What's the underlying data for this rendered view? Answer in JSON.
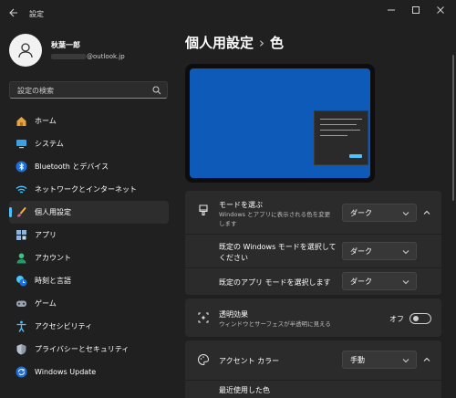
{
  "window": {
    "title": "設定",
    "back_icon": "arrow-left-icon",
    "controls": [
      "minimize-icon",
      "maximize-icon",
      "close-icon"
    ]
  },
  "profile": {
    "name": "秋葉一郎",
    "email_suffix": "@outlook.jp"
  },
  "search": {
    "placeholder": "設定の検索"
  },
  "sidebar": {
    "items": [
      {
        "label": "ホーム",
        "icon": "home-icon"
      },
      {
        "label": "システム",
        "icon": "monitor-icon"
      },
      {
        "label": "Bluetooth とデバイス",
        "icon": "bluetooth-icon"
      },
      {
        "label": "ネットワークとインターネット",
        "icon": "wifi-icon"
      },
      {
        "label": "個人用設定",
        "icon": "brush-icon",
        "active": true
      },
      {
        "label": "アプリ",
        "icon": "apps-icon"
      },
      {
        "label": "アカウント",
        "icon": "account-icon"
      },
      {
        "label": "時刻と言語",
        "icon": "clock-globe-icon"
      },
      {
        "label": "ゲーム",
        "icon": "gamepad-icon"
      },
      {
        "label": "アクセシビリティ",
        "icon": "accessibility-icon"
      },
      {
        "label": "プライバシーとセキュリティ",
        "icon": "shield-icon"
      },
      {
        "label": "Windows Update",
        "icon": "update-icon"
      }
    ]
  },
  "header": {
    "parent": "個人用設定",
    "separator": "›",
    "current": "色"
  },
  "mode_card": {
    "title": "モードを選ぶ",
    "description_line1": "Windows とアプリに表示される色を変更",
    "description_line2": "します",
    "value": "ダーク",
    "windows_mode_label_line1": "既定の Windows モードを選択して",
    "windows_mode_label_line2": "ください",
    "windows_mode_value": "ダーク",
    "app_mode_label": "既定のアプリ モードを選択します",
    "app_mode_value": "ダーク"
  },
  "transparency_card": {
    "title": "透明効果",
    "description": "ウィンドウとサーフェスが半透明に見える",
    "toggle_label": "オフ",
    "enabled": false
  },
  "accent_card": {
    "title": "アクセント カラー",
    "value": "手動",
    "recent_label": "最近使用した色"
  },
  "colors": {
    "accent": "#4cc2ff",
    "wallpaper": "#0e5ab8",
    "background": "#202020",
    "card": "#2b2b2b"
  }
}
